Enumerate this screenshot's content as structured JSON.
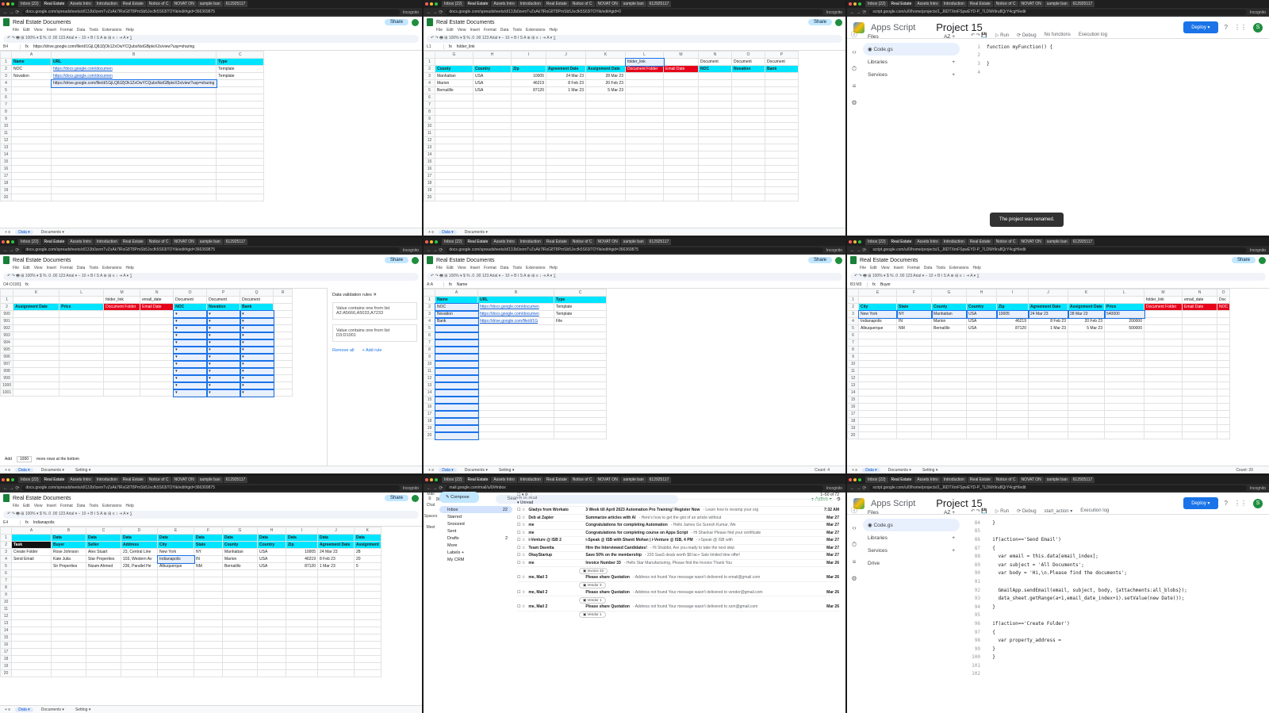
{
  "common": {
    "tab_titles": [
      "Inbox (22)",
      "Real Estate",
      "Assets Intro",
      "Introduction",
      "Real Estate",
      "Notice of C",
      "NOVAT ON",
      "sample ban",
      "612925117"
    ],
    "incognito": "Incognito",
    "share": "Share",
    "menu": [
      "File",
      "Edit",
      "View",
      "Insert",
      "Format",
      "Data",
      "Tools",
      "Extensions",
      "Help"
    ],
    "sheet_title": "Real Estate Documents",
    "toolbar": "↶ ↷ 🖶 ⊞ 100% ▾ $ % .0 .00 123 Arial ▾ − 10 + B I S A ⊕ ⊞ ≡ ↕ ⇥ A ▾ ∑"
  },
  "p1": {
    "url": "docs.google.com/spreadsheets/d/13Jb0zemTvZsAk7lRsG8T8PmSb5Jocfk5S63iTOYik/edit#gid=366369875",
    "ref": "B4",
    "formula": "https://drive.google.com/file/d/1GjLQ8JZjOk1ZxOwYCQubsNstGBpteX2s/view?usp=sharing",
    "cols": [
      "A",
      "B",
      "C"
    ],
    "rows": [
      [
        "Name",
        "URL",
        "Type"
      ],
      [
        "NOC",
        "https://docs.google.com/documen",
        "Template"
      ],
      [
        "Novation",
        "https://docs.google.com/documen",
        "Template"
      ],
      [
        "",
        "https://drive.google.com/file/d/1GjLQ8JZjOk1ZxOwYCQubsNstGBpteX2s/view?usp=sharing",
        ""
      ]
    ],
    "tabs": [
      "Data",
      "Documents"
    ]
  },
  "p2": {
    "url": "docs.google.com/spreadsheets/d/13Jb0zemTvZsAk7lRsG8T8PmSb5Jocfk5S63iTOYik/edit#gid=0",
    "ref": "L1",
    "formula": "folder_link",
    "cols": [
      "G",
      "H",
      "I",
      "J",
      "K",
      "L",
      "M",
      "N",
      "O",
      "P"
    ],
    "row1": [
      "",
      "",
      "",
      "",
      "",
      "folder_link",
      "",
      "Document",
      "Document",
      "Document"
    ],
    "row2": [
      "County",
      "Country",
      "Zip",
      "Agreement Date",
      "Assignment Date",
      "Document Folder",
      "Email Date",
      "NOC",
      "Novation",
      "Bank"
    ],
    "data": [
      [
        "Manhattan",
        "USA",
        "10005",
        "24 Mar 23",
        "28 Mar 23"
      ],
      [
        "Marion",
        "USA",
        "46219",
        "8 Feb 23",
        "20 Feb 23"
      ],
      [
        "Bernalillo",
        "USA",
        "87120",
        "1 Mar 23",
        "5 Mar 23"
      ]
    ],
    "tabs": [
      "Data",
      "Documents"
    ]
  },
  "p3": {
    "url": "script.google.com/u/0/home/projects/1_J6DTXmFSpwEYD-P_7LDWr9ru8QrY4cgH/edit",
    "brand": "Apps Script",
    "project": "Project 15",
    "deploy": "Deploy",
    "files": "Files",
    "codefile": "Code.gs",
    "libraries": "Libraries",
    "services": "Services",
    "run": "Run",
    "debug": "Debug",
    "nofn": "No functions",
    "exec": "Execution log",
    "code": [
      {
        "n": "1",
        "t": "function myFunction() {"
      },
      {
        "n": "2",
        "t": ""
      },
      {
        "n": "3",
        "t": "}"
      },
      {
        "n": "4",
        "t": ""
      }
    ],
    "toast": "The project was renamed."
  },
  "p4": {
    "ref": "O4:O1001",
    "cols": [
      "K",
      "L",
      "M",
      "N",
      "O",
      "P",
      "Q",
      "R"
    ],
    "row1": [
      "",
      "",
      "folder_link",
      "email_date",
      "Document",
      "Document",
      "Document"
    ],
    "row2": [
      "Assignment Date",
      "Price",
      "Document Folder",
      "Email Date",
      "NOC",
      "Novation",
      "Bank"
    ],
    "rownums": [
      "990",
      "991",
      "992",
      "993",
      "994",
      "995",
      "996",
      "997",
      "998",
      "999",
      "1000",
      "1001"
    ],
    "panel_title": "Data validation rules",
    "rule1": "Value contains one from list",
    "rule1b": "A2:A5666,A5033,A7233",
    "rule2": "Value contains one from list",
    "rule2b": "D3:D1001",
    "remove": "Remove all",
    "add": "Add rule",
    "add_rows": "Add",
    "rows_n": "1000",
    "more": "more rows at the bottom",
    "tabs": [
      "Data",
      "Documents",
      "Setting"
    ]
  },
  "p5": {
    "ref": "A:A",
    "formula": "Name",
    "cols": [
      "A",
      "B",
      "C"
    ],
    "rows": [
      [
        "Name",
        "URL",
        "Type"
      ],
      [
        "NOC",
        "https://docs.google.com/documen",
        "Template"
      ],
      [
        "Novation",
        "https://docs.google.com/documen",
        "Template"
      ],
      [
        "Bank",
        "https://drive.google.com/file/d/1G",
        "File"
      ]
    ],
    "tabs": [
      "Data",
      "Documents",
      "Setting"
    ],
    "status": "Count: 4"
  },
  "p6": {
    "ref": "B3:M3",
    "formula": "Buyer",
    "cols": [
      "E",
      "F",
      "G",
      "H",
      "I",
      "J",
      "K",
      "L",
      "M",
      "N",
      "O"
    ],
    "row2": [
      "City",
      "State",
      "County",
      "Country",
      "Zip",
      "Agreement Date",
      "Assignment Date",
      "Price",
      "Document Folder",
      "Email Date",
      "NOC"
    ],
    "row1": [
      "",
      "",
      "",
      "",
      "",
      "",
      "",
      "",
      "folder_link",
      "email_date",
      "Doc"
    ],
    "data": [
      [
        "New York",
        "NY",
        "Manhattan",
        "USA",
        "10005",
        "24 Mar 23",
        "28 Mar 23",
        "540000"
      ],
      [
        "Indianapolis",
        "IN",
        "Marion",
        "USA",
        "46219",
        "8 Feb 23",
        "20 Feb 23",
        "200000"
      ],
      [
        "Albuquerque",
        "NM",
        "Bernalillo",
        "USA",
        "87120",
        "1 Mar 23",
        "5 Mar 23",
        "500000"
      ]
    ],
    "tabs": [
      "Data",
      "Documents",
      "Setting"
    ],
    "status": "Count: 20"
  },
  "p7": {
    "ref": "E4",
    "formula": "Indianapolis",
    "cols": [
      "A",
      "B",
      "C",
      "D",
      "E",
      "F",
      "G",
      "H",
      "I",
      "J",
      "K"
    ],
    "row1": [
      "",
      "Data",
      "Data",
      "Data",
      "Data",
      "Data",
      "Data",
      "Data",
      "Data",
      "Data",
      "Data"
    ],
    "row2": [
      "Task",
      "Buyer",
      "Seller",
      "Address",
      "City",
      "State",
      "County",
      "Country",
      "Zip",
      "Agreement Date",
      "Assignment"
    ],
    "data": [
      [
        "Create Folder",
        "Rose Johnson",
        "Alex Stuart",
        "23, Central Line",
        "New York",
        "NY",
        "Manhattan",
        "USA",
        "10005",
        "24 Mar 23",
        "28"
      ],
      [
        "Send Email",
        "Kate Julia",
        "Star Properties",
        "103, Western Av",
        "Indianapolis",
        "IN",
        "Marion",
        "USA",
        "46219",
        "8 Feb 23",
        "20"
      ],
      [
        "",
        "Sir Properties",
        "Nizam Ahmed",
        "236, Parallel He",
        "Albuquerque",
        "NM",
        "Bernalillo",
        "USA",
        "87120",
        "1 Mar 23",
        "5"
      ]
    ],
    "tabs": [
      "Data",
      "Documents",
      "Setting"
    ]
  },
  "p8": {
    "url": "mail.google.com/mail/u/0/#inbox",
    "brand": "Gmail",
    "search": "Search in mail",
    "active": "Active",
    "compose": "Compose",
    "folders": [
      {
        "l": "Inbox",
        "c": "22"
      },
      {
        "l": "Starred",
        "c": ""
      },
      {
        "l": "Snoozed",
        "c": ""
      },
      {
        "l": "Sent",
        "c": ""
      },
      {
        "l": "Drafts",
        "c": "2"
      },
      {
        "l": "More",
        "c": ""
      }
    ],
    "labels": "Labels",
    "label1": "My CRM",
    "unread": "Unread",
    "pager": "1–50 of 72",
    "mails": [
      {
        "s": "Gladys from Workato",
        "sub": "3 Week till April 2023 Automation Pro Training! Register Now",
        "p": "- Learn how to revamp your org",
        "d": "7:32 AM"
      },
      {
        "s": "Deb at Zapier",
        "sub": "Summarize articles with AI",
        "p": "- Here's how to get the gist of an article without",
        "d": "Mar 27"
      },
      {
        "s": "me",
        "sub": "Congratulations for completing Automation",
        "p": "- Hello James Go Suresh Kumar, We",
        "d": "Mar 27"
      },
      {
        "s": "me",
        "sub": "Congratulations for completing course on Apps Script",
        "p": "- Hi Shankar Please find your certificate",
        "d": "Mar 27"
      },
      {
        "s": "i-Venture @ ISB 2",
        "sub": "i-Speak @ ISB with Shanti Mohan | i-Venture @ ISB, 4 PM",
        "p": "- i-Speak @ ISB with",
        "d": "Mar 27"
      },
      {
        "s": "Team Davetta",
        "sub": "Hire the Interviewed Candidates!",
        "p": "- Hi Shabbir, Are you ready to take the next step",
        "d": "Mar 27"
      },
      {
        "s": "OkayStartup",
        "sub": "Save 50% on the membership",
        "p": "- 220 SaaS deals worth $8 lac+ Sale limited time offer!",
        "d": "Mar 27"
      },
      {
        "s": "me",
        "sub": "Invoice Number 33",
        "p": "- Hello Star Manufacturing, Please find the Invoice Thank You",
        "d": "Mar 26"
      }
    ],
    "att1": "Invoice 33",
    "mails2": [
      {
        "s": "me, Mail 3",
        "sub": "Please share Quotation",
        "p": "- Address not found Your message wasn't delivered to email@gmail.com",
        "d": "Mar 26"
      },
      {
        "s": "me, Mail 2",
        "sub": "Please share Quotation",
        "p": "- Address not found Your message wasn't delivered to vendor@gmail.com",
        "d": "Mar 26"
      },
      {
        "s": "me, Mail 2",
        "sub": "Please share Quotation",
        "p": "- Address not found Your message wasn't delivered to xzm@gmail.com",
        "d": "Mar 26"
      }
    ],
    "atts": [
      "Vendor 3",
      "Vendor 1",
      "Vendor 1"
    ]
  },
  "p9": {
    "project": "Project 15",
    "brand": "Apps Script",
    "deploy": "Deploy",
    "files": "Files",
    "codefile": "Code.gs",
    "libraries": "Libraries",
    "services": "Services",
    "drive": "Drive",
    "run": "Run",
    "debug": "Debug",
    "fn": "start_action",
    "exec": "Execution log",
    "code": [
      {
        "n": "84",
        "t": "  }"
      },
      {
        "n": "85",
        "t": ""
      },
      {
        "n": "86",
        "t": "  if(action=='Send Email')"
      },
      {
        "n": "87",
        "t": "  {"
      },
      {
        "n": "88",
        "t": "    var email = this.data[email_index];"
      },
      {
        "n": "89",
        "t": "    var subject = 'All Documents';"
      },
      {
        "n": "90",
        "t": "    var body = 'Hi,\\n.Please find the documents';"
      },
      {
        "n": "91",
        "t": ""
      },
      {
        "n": "92",
        "t": "    GmailApp.sendEmail(email, subject, body, {attachments:all_blobs});"
      },
      {
        "n": "93",
        "t": "    data_sheet.getRange(a+1,email_date_index+1).setValue(new Date());"
      },
      {
        "n": "94",
        "t": "  }"
      },
      {
        "n": "95",
        "t": ""
      },
      {
        "n": "96",
        "t": "  if(action=='Create Folder')"
      },
      {
        "n": "97",
        "t": "  {"
      },
      {
        "n": "98",
        "t": "    var property_address = "
      },
      {
        "n": "99",
        "t": "  }"
      },
      {
        "n": "100",
        "t": "  }"
      },
      {
        "n": "101",
        "t": ""
      },
      {
        "n": "102",
        "t": ""
      }
    ]
  },
  "colors": {
    "cyan": "#00e5ff",
    "red": "#e6001a",
    "blue": "#1a73e8",
    "green": "#188038"
  }
}
